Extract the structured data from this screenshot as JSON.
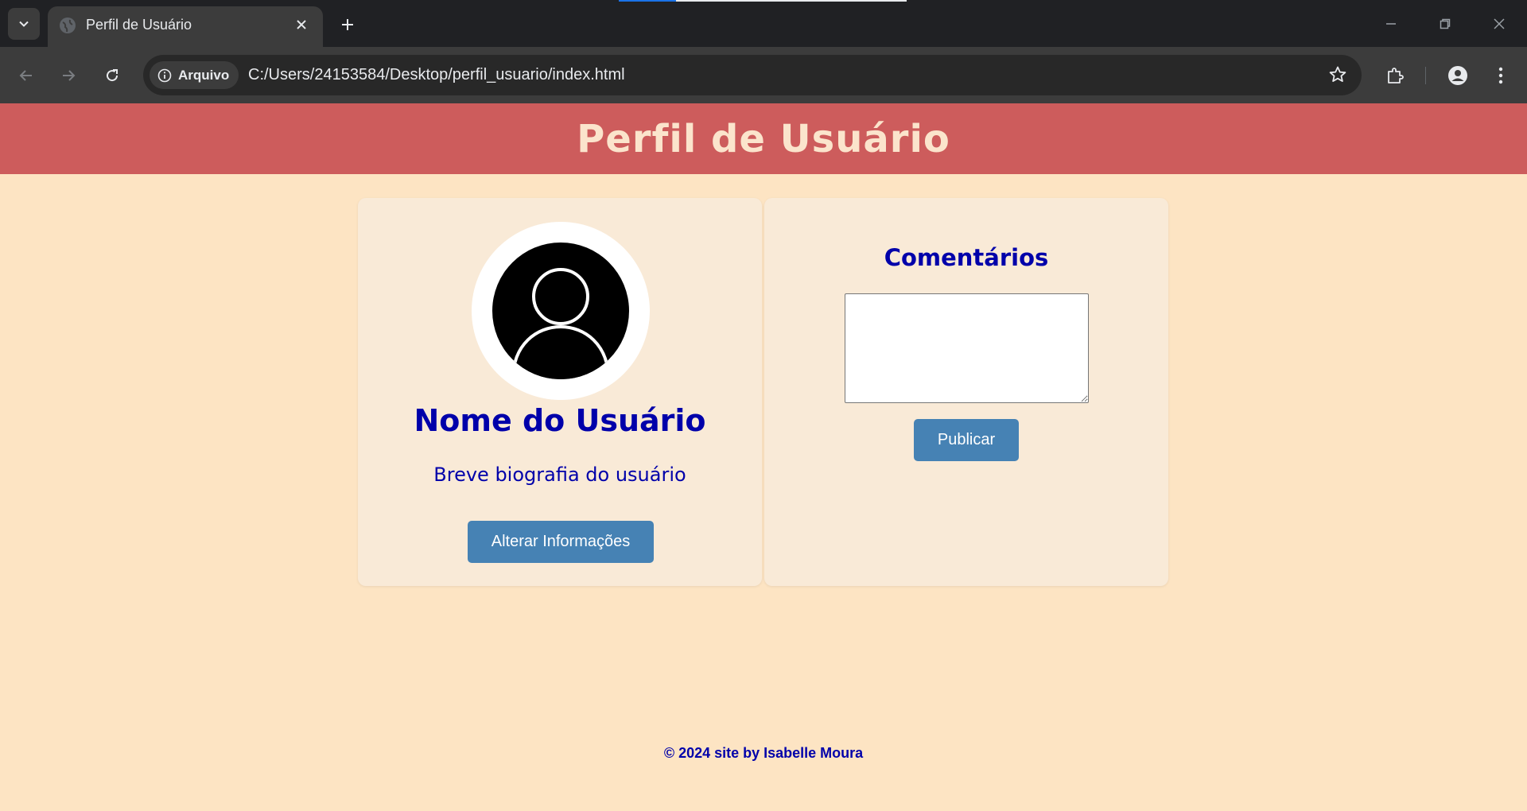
{
  "browser": {
    "tab": {
      "title": "Perfil de Usuário"
    },
    "site_chip": "Arquivo",
    "url": "C:/Users/24153584/Desktop/perfil_usuario/index.html"
  },
  "page": {
    "header_title": "Perfil de Usuário",
    "profile": {
      "name": "Nome do Usuário",
      "bio": "Breve biografia do usuário",
      "edit_button": "Alterar Informações"
    },
    "comments": {
      "title": "Comentários",
      "textarea_value": "",
      "publish_button": "Publicar"
    },
    "footer": "© 2024 site by Isabelle Moura"
  },
  "colors": {
    "header_bg": "#cd5c5c",
    "page_bg": "#fde4c3",
    "card_bg": "#f9ead7",
    "text_blue": "#0000aa",
    "button_bg": "#4682b4"
  }
}
